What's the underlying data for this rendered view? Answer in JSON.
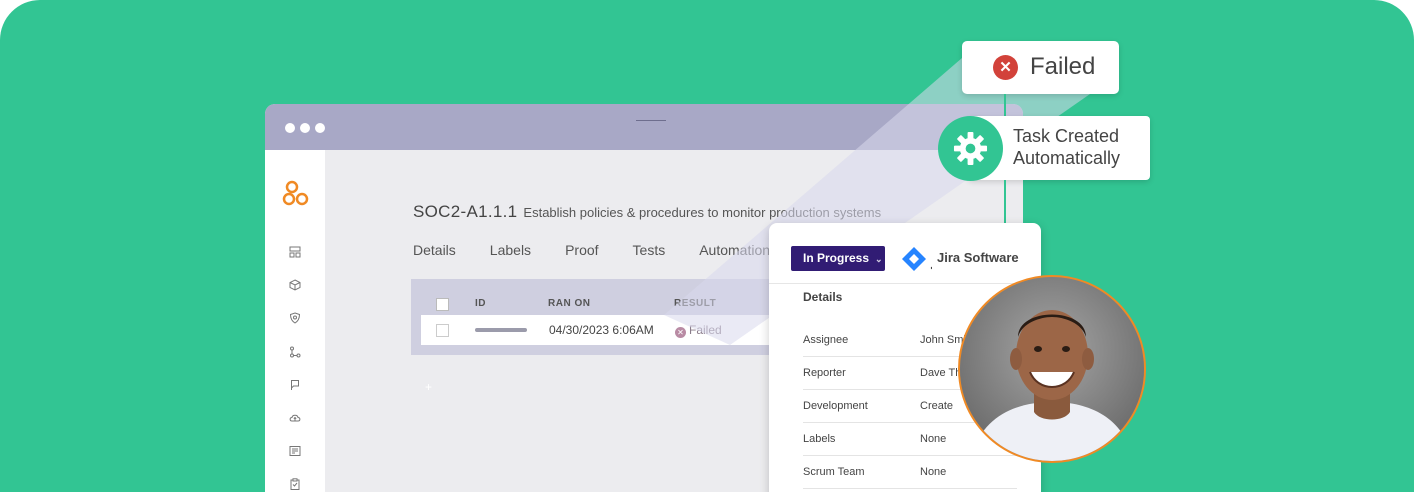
{
  "window": {
    "control_title": "SOC2-A1.1.1",
    "control_desc": "Establish policies & procedures to monitor production systems",
    "tabs": [
      "Details",
      "Labels",
      "Proof",
      "Tests",
      "Automation"
    ]
  },
  "sidebar_icons": [
    "dashboard-icon",
    "package-icon",
    "shield-icon",
    "workflow-icon",
    "flag-icon",
    "cloud-upload-icon",
    "report-icon",
    "clipboard-icon"
  ],
  "table": {
    "headers": {
      "id": "ID",
      "ran_on": "RAN ON",
      "result": "RESULT"
    },
    "row": {
      "ran_on": "04/30/2023 6:06AM",
      "result": "Failed"
    }
  },
  "callouts": {
    "failed": "Failed",
    "task_line1": "Task Created",
    "task_line2": "Automatically"
  },
  "jira": {
    "status": "In Progress",
    "product": "Jira Software",
    "details_title": "Details",
    "fields": [
      {
        "label": "Assignee",
        "value": "John Smi"
      },
      {
        "label": "Reporter",
        "value": "Dave Th"
      },
      {
        "label": "Development",
        "value": "Create"
      },
      {
        "label": "Labels",
        "value": "None"
      },
      {
        "label": "Scrum Team",
        "value": "None"
      }
    ]
  },
  "colors": {
    "background": "#32c593",
    "failed_red": "#d2423a",
    "status_purple": "#311c74",
    "jira_blue": "#2684ff",
    "avatar_ring": "#f08a24",
    "logo_orange": "#f08a24"
  }
}
